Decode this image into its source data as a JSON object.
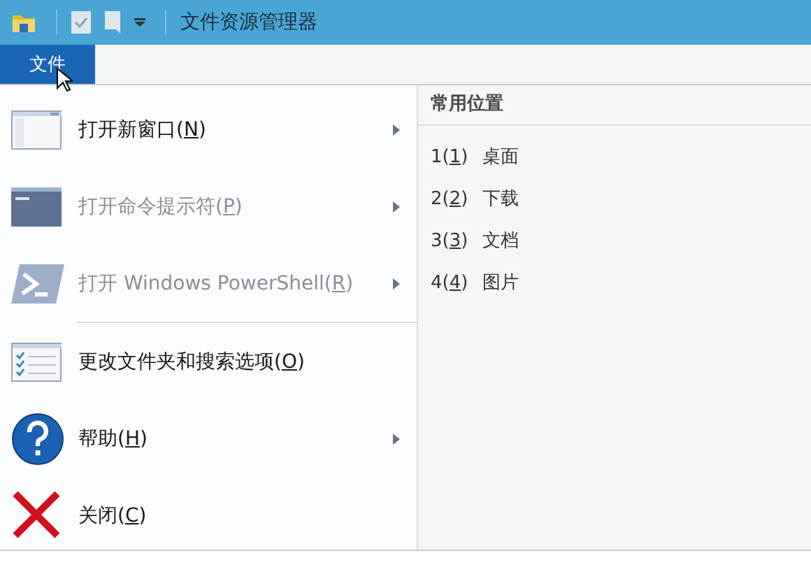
{
  "window": {
    "title": "文件资源管理器"
  },
  "ribbon": {
    "tabs": [
      {
        "label": "文件",
        "selected": true
      }
    ]
  },
  "menu": {
    "items": [
      {
        "kind": "new-window",
        "before": "打开新窗口(",
        "key": "N",
        "after": ")",
        "disabled": false,
        "submenu": true,
        "separator_before": false
      },
      {
        "kind": "cmd",
        "before": "打开命令提示符(",
        "key": "P",
        "after": ")",
        "disabled": true,
        "submenu": true,
        "separator_before": false
      },
      {
        "kind": "powershell",
        "before": "打开 Windows PowerShell(",
        "key": "R",
        "after": ")",
        "disabled": true,
        "submenu": true,
        "separator_before": false
      },
      {
        "kind": "options",
        "before": "更改文件夹和搜索选项(",
        "key": "O",
        "after": ")",
        "disabled": false,
        "submenu": false,
        "separator_before": true
      },
      {
        "kind": "help",
        "before": "帮助(",
        "key": "H",
        "after": ")",
        "disabled": false,
        "submenu": true,
        "separator_before": false
      },
      {
        "kind": "close",
        "before": "关闭(",
        "key": "C",
        "after": ")",
        "disabled": false,
        "submenu": false,
        "separator_before": false
      }
    ]
  },
  "frequent_places": {
    "title": "常用位置",
    "items": [
      {
        "number": "1(",
        "key": "1",
        "after": ")",
        "name": "桌面"
      },
      {
        "number": "2(",
        "key": "2",
        "after": ")",
        "name": "下载"
      },
      {
        "number": "3(",
        "key": "3",
        "after": ")",
        "name": "文档"
      },
      {
        "number": "4(",
        "key": "4",
        "after": ")",
        "name": "图片"
      }
    ]
  }
}
